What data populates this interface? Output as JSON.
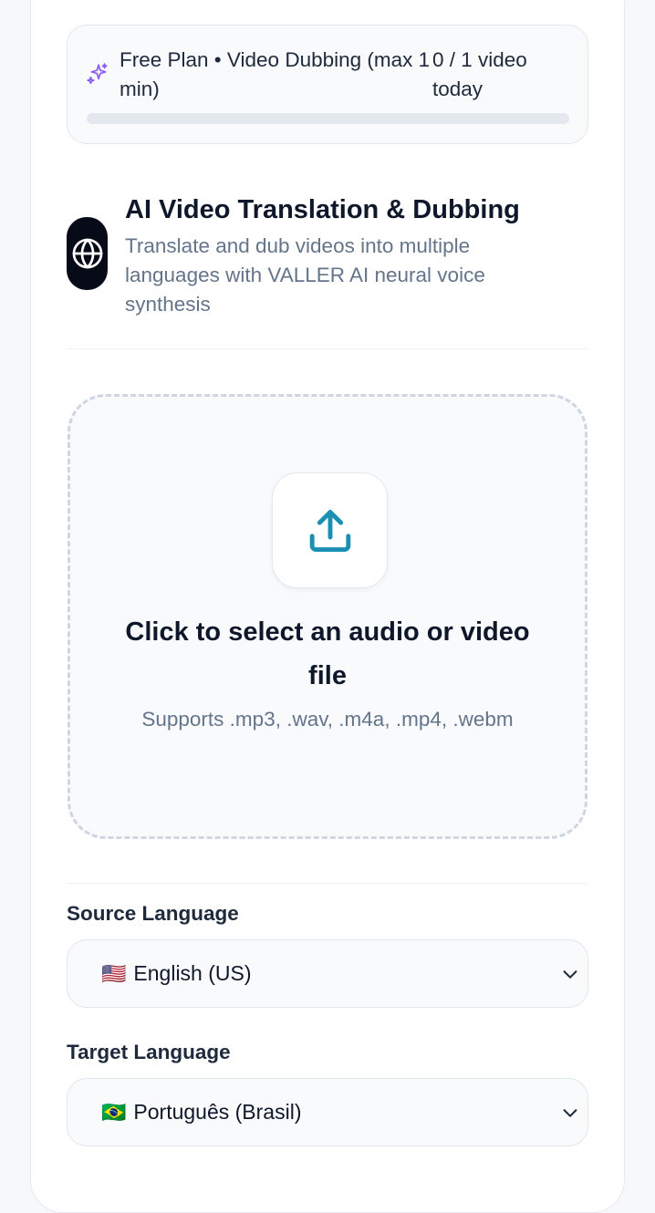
{
  "plan": {
    "title": "Free Plan • Video Dubbing (max 1 min)",
    "usage": "0 / 1 video today",
    "used_fraction": 0,
    "accent_color": "#8b5cf6"
  },
  "feature": {
    "icon": "globe-icon",
    "title": "AI Video Translation & Dubbing",
    "description": "Translate and dub videos into multiple languages with VALLER AI neural voice synthesis"
  },
  "upload": {
    "icon": "upload-icon",
    "icon_color": "#1b8fb3",
    "title": "Click to select an audio or video file",
    "formats": "Supports .mp3, .wav, .m4a, .mp4, .webm"
  },
  "source_language": {
    "label": "Source Language",
    "flag": "🇺🇸",
    "value": "English (US)"
  },
  "target_language": {
    "label": "Target Language",
    "flag": "🇧🇷",
    "value": "Português (Brasil)"
  }
}
